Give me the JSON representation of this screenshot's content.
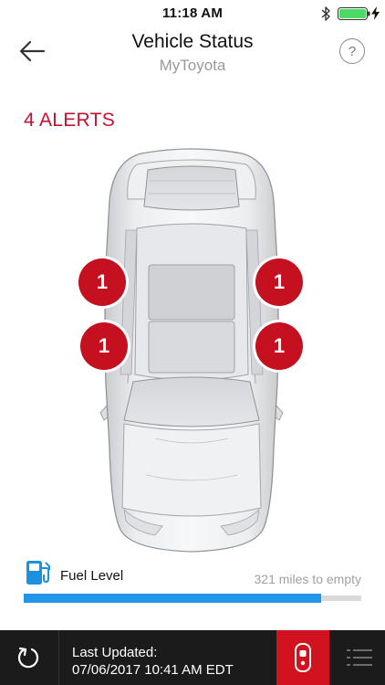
{
  "status_bar": {
    "time": "11:18 AM",
    "icons": [
      "bluetooth-icon",
      "battery-icon",
      "charging-icon"
    ],
    "battery_color": "#4cd964"
  },
  "header": {
    "title": "Vehicle Status",
    "subtitle": "MyToyota",
    "back_icon": "arrow-left-icon",
    "help_label": "?"
  },
  "alerts": {
    "summary": "4 ALERTS",
    "color": "#c8102e",
    "badges": [
      {
        "position": "front-left-door",
        "count": "1"
      },
      {
        "position": "front-right-door",
        "count": "1"
      },
      {
        "position": "rear-left-door",
        "count": "1"
      },
      {
        "position": "rear-right-door",
        "count": "1"
      }
    ]
  },
  "fuel": {
    "label": "Fuel Level",
    "range_text": "321 miles to empty",
    "level_fraction": 0.88,
    "icon": "fuel-pump-icon",
    "color": "#2196e8"
  },
  "footer": {
    "updated_label": "Last Updated:",
    "updated_value": "07/06/2017 10:41 AM EDT",
    "refresh_icon": "refresh-icon",
    "vehicle_icon": "vehicle-key-icon",
    "menu_icon": "list-menu-icon",
    "accent": "#d0131f"
  }
}
